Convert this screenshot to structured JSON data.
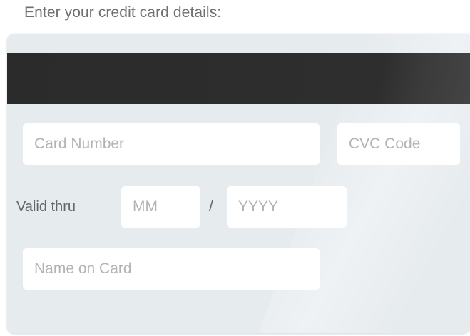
{
  "prompt": "Enter your credit card details:",
  "card_form": {
    "card_number_placeholder": "Card Number",
    "cvc_placeholder": "CVC Code",
    "valid_thru_label": "Valid thru",
    "month_placeholder": "MM",
    "separator": "/",
    "year_placeholder": "YYYY",
    "name_placeholder": "Name on Card"
  },
  "colors": {
    "card_background": "#e6ebee",
    "magnetic_stripe": "#2e2e2e",
    "field_background": "#ffffff",
    "placeholder_text": "#b0b4b7"
  }
}
